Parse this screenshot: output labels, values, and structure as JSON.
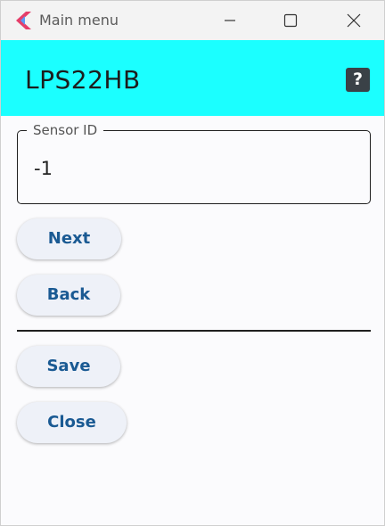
{
  "window": {
    "title": "Main menu",
    "app_icon": "flutter-logo-icon",
    "controls": {
      "minimize_icon": "minimize-icon",
      "maximize_icon": "maximize-icon",
      "close_icon": "close-icon"
    }
  },
  "header": {
    "title": "LPS22HB",
    "help_label": "?",
    "background_color": "#1bffff"
  },
  "sensor_field": {
    "label": "Sensor ID",
    "value": "-1"
  },
  "buttons": {
    "next": "Next",
    "back": "Back",
    "save": "Save",
    "close": "Close"
  },
  "colors": {
    "button_text": "#1a5a93",
    "button_bg": "#eef1f8",
    "help_bg": "#3a4147"
  }
}
